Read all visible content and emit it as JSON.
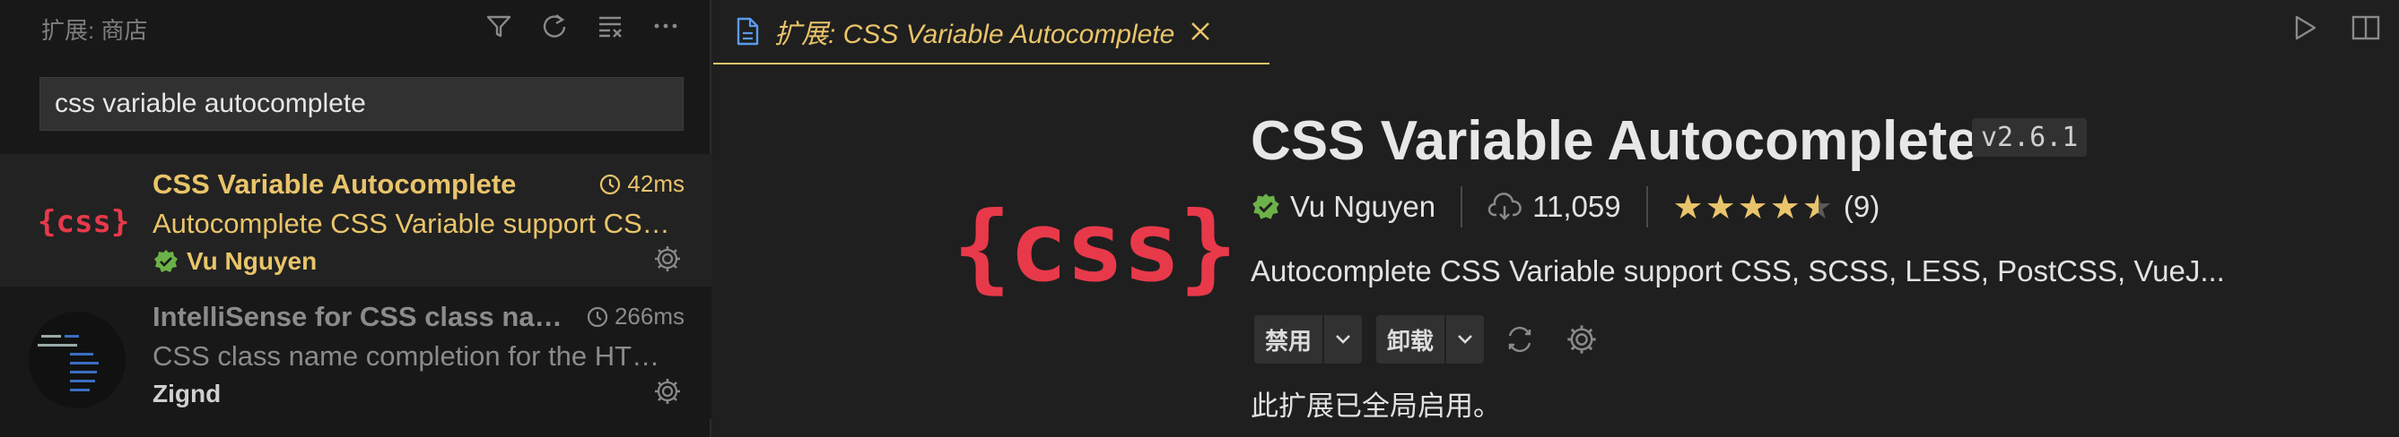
{
  "sidebar": {
    "title": "扩展: 商店",
    "actions": [
      "filter-icon",
      "refresh-icon",
      "clear-icon",
      "more-icon"
    ],
    "search": {
      "value": "css variable autocomplete"
    },
    "items": [
      {
        "name": "CSS Variable Autocomplete",
        "description": "Autocomplete CSS Variable support CSS, SCSS, LESS, PostCSS, VueJS",
        "publisher": "Vu Nguyen",
        "time": "42ms",
        "icon_text": "{css}",
        "verified": true
      },
      {
        "name": "IntelliSense for CSS class names in HTML",
        "description": "CSS class name completion for the HTML class attribute",
        "publisher": "Zignd",
        "time": "266ms",
        "verified": false
      }
    ]
  },
  "tab": {
    "title": "扩展: CSS Variable Autocomplete"
  },
  "detail": {
    "logo_text": "{css}",
    "name": "CSS Variable Autocomplete",
    "version": "v2.6.1",
    "publisher": "Vu Nguyen",
    "installs": "11,059",
    "rating_stars": 4.5,
    "rating_count": "(9)",
    "description": "Autocomplete CSS Variable support CSS, SCSS, LESS, PostCSS, VueJ...",
    "buttons": {
      "disable": "禁用",
      "uninstall": "卸载"
    },
    "status": "此扩展已全局启用。"
  },
  "colors": {
    "accent": "#e9c46a",
    "css_red": "#e8394a",
    "verified_green": "#6cb248"
  }
}
